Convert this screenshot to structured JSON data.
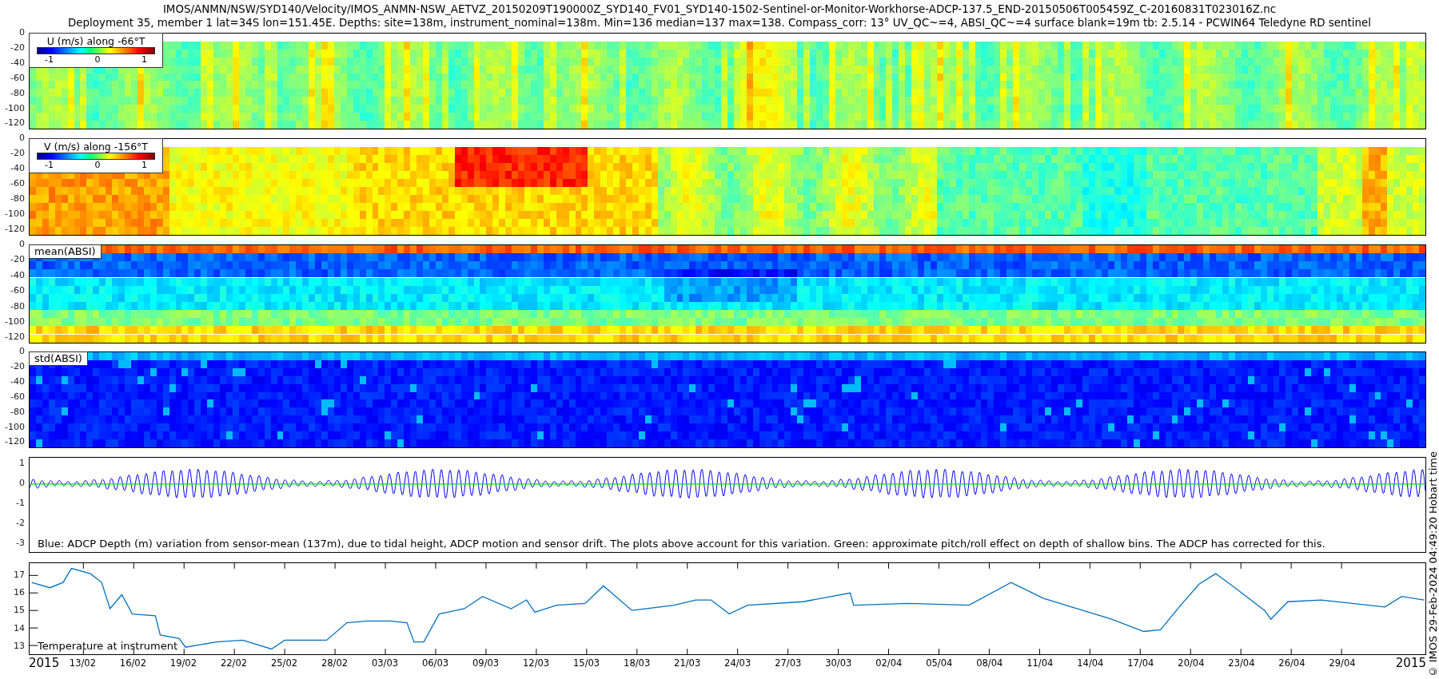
{
  "title_lines": [
    "IMOS/ANMN/NSW/SYD140/Velocity/IMOS_ANMN-NSW_AETVZ_20150209T190000Z_SYD140_FV01_SYD140-1502-Sentinel-or-Monitor-Workhorse-ADCP-137.5_END-20150506T005459Z_C-20160831T023016Z.nc",
    "Deployment 35, member 1 lat=34S lon=151.45E. Depths: site=138m, instrument_nominal=138m. Min=136 median=137 max=138. Compass_corr: 13° UV_QC~=4, ABSI_QC~=4 surface blank=19m tb: 2.5.14 - PCWIN64 Teledyne RD sentinel"
  ],
  "heatmaps": [
    {
      "kind": "u",
      "label": "U (m/s) along -66°T",
      "colorbar_ticks": [
        "-1",
        "0",
        "1"
      ],
      "yticks": [
        "0",
        "-20",
        "-40",
        "-60",
        "-80",
        "-100",
        "-120"
      ]
    },
    {
      "kind": "v",
      "label": "V (m/s) along -156°T",
      "colorbar_ticks": [
        "-1",
        "0",
        "1"
      ],
      "yticks": [
        "0",
        "-20",
        "-40",
        "-60",
        "-80",
        "-100",
        "-120"
      ]
    },
    {
      "kind": "mean",
      "label": "mean(ABSI)",
      "yticks": [
        "0",
        "-20",
        "-40",
        "-60",
        "-80",
        "-100",
        "-120"
      ]
    },
    {
      "kind": "std",
      "label": "std(ABSI)",
      "yticks": [
        "0",
        "-20",
        "-40",
        "-60",
        "-80",
        "-100",
        "-120"
      ]
    }
  ],
  "depth_panel": {
    "yticks": [
      "1",
      "0",
      "-1",
      "-2",
      "-3"
    ],
    "caption": "Blue: ADCP Depth (m) variation from sensor-mean (137m), due to tidal height, ADCP motion and sensor drift. The plots above account for this variation. Green: approximate pitch/roll effect on depth of shallow bins. The ADCP has corrected for this."
  },
  "temperature_panel": {
    "chart_data": {
      "type": "line",
      "xlim": [
        "2015-02-09T19:00",
        "2015-05-04T00:00"
      ],
      "ylim": [
        12.5,
        17.7
      ],
      "yticks": [
        13,
        14,
        15,
        16,
        17
      ],
      "xticks": [
        {
          "value": "2015-02-13",
          "label": "13/02"
        },
        {
          "value": "2015-02-16",
          "label": "16/02"
        },
        {
          "value": "2015-02-19",
          "label": "19/02"
        },
        {
          "value": "2015-02-22",
          "label": "22/02"
        },
        {
          "value": "2015-02-25",
          "label": "25/02"
        },
        {
          "value": "2015-02-28",
          "label": "28/02"
        },
        {
          "value": "2015-03-03",
          "label": "03/03"
        },
        {
          "value": "2015-03-06",
          "label": "06/03"
        },
        {
          "value": "2015-03-09",
          "label": "09/03"
        },
        {
          "value": "2015-03-12",
          "label": "12/03"
        },
        {
          "value": "2015-03-15",
          "label": "15/03"
        },
        {
          "value": "2015-03-18",
          "label": "18/03"
        },
        {
          "value": "2015-03-21",
          "label": "21/03"
        },
        {
          "value": "2015-03-24",
          "label": "24/03"
        },
        {
          "value": "2015-03-27",
          "label": "27/03"
        },
        {
          "value": "2015-03-30",
          "label": "30/03"
        },
        {
          "value": "2015-04-02",
          "label": "02/04"
        },
        {
          "value": "2015-04-05",
          "label": "05/04"
        },
        {
          "value": "2015-04-08",
          "label": "08/04"
        },
        {
          "value": "2015-04-11",
          "label": "11/04"
        },
        {
          "value": "2015-04-14",
          "label": "14/04"
        },
        {
          "value": "2015-04-17",
          "label": "17/04"
        },
        {
          "value": "2015-04-20",
          "label": "20/04"
        },
        {
          "value": "2015-04-23",
          "label": "23/04"
        },
        {
          "value": "2015-04-26",
          "label": "26/04"
        },
        {
          "value": "2015-04-29",
          "label": "29/04"
        }
      ],
      "x": [
        "2015-02-09T22:00",
        "2015-02-11T00:00",
        "2015-02-11T19:00",
        "2015-02-12T07:00",
        "2015-02-13T10:00",
        "2015-02-14T02:00",
        "2015-02-14T14:00",
        "2015-02-15T07:00",
        "2015-02-15T22:00",
        "2015-02-17T07:00",
        "2015-02-17T14:00",
        "2015-02-18T17:00",
        "2015-02-19T02:00",
        "2015-02-20T22:00",
        "2015-02-22T12:00",
        "2015-02-24T05:00",
        "2015-02-25T00:00",
        "2015-02-27T12:00",
        "2015-02-28T17:00",
        "2015-03-01T22:00",
        "2015-03-03T07:00",
        "2015-03-04T07:00",
        "2015-03-04T17:00",
        "2015-03-05T07:00",
        "2015-03-06T05:00",
        "2015-03-07T17:00",
        "2015-03-08T19:00",
        "2015-03-10T12:00",
        "2015-03-11T10:00",
        "2015-03-11T22:00",
        "2015-03-13T05:00",
        "2015-03-14T22:00",
        "2015-03-16T00:00",
        "2015-03-17T17:00",
        "2015-03-20T05:00",
        "2015-03-21T12:00",
        "2015-03-22T10:00",
        "2015-03-23T12:00",
        "2015-03-24T14:00",
        "2015-03-27T22:00",
        "2015-03-30T17:00",
        "2015-03-30T22:00",
        "2015-04-03T05:00",
        "2015-04-06T19:00",
        "2015-04-09T07:00",
        "2015-04-11T05:00",
        "2015-04-12T22:00",
        "2015-04-15T07:00",
        "2015-04-17T05:00",
        "2015-04-18T05:00",
        "2015-04-19T10:00",
        "2015-04-20T12:00",
        "2015-04-21T12:00",
        "2015-04-22T12:00",
        "2015-04-24T10:00",
        "2015-04-24T19:00",
        "2015-04-25T19:00",
        "2015-04-27T19:00",
        "2015-05-01T14:00",
        "2015-05-02T14:00",
        "2015-05-03T22:00"
      ],
      "series": [
        {
          "name": "Temperature at instrument",
          "color": "#0072bd",
          "values": [
            16.6,
            16.3,
            16.6,
            17.4,
            17.1,
            16.6,
            15.1,
            15.9,
            14.8,
            14.7,
            13.6,
            13.4,
            12.9,
            13.2,
            13.3,
            12.8,
            13.3,
            13.3,
            14.3,
            14.4,
            14.4,
            14.3,
            13.2,
            13.2,
            14.8,
            15.1,
            15.8,
            15.1,
            15.6,
            14.9,
            15.3,
            15.4,
            16.4,
            15.0,
            15.3,
            15.6,
            15.6,
            14.8,
            15.3,
            15.5,
            16.0,
            15.3,
            15.4,
            15.3,
            16.6,
            15.7,
            15.2,
            14.5,
            13.8,
            13.9,
            15.3,
            16.5,
            17.1,
            16.4,
            15.0,
            14.5,
            15.5,
            15.6,
            15.2,
            15.8,
            15.6
          ]
        }
      ]
    }
  },
  "x_axis": {
    "start_label": "2015",
    "end_label": "2015"
  },
  "side_note": "© IMOS 29-Feb-2024 04:49:20 Hobart time"
}
